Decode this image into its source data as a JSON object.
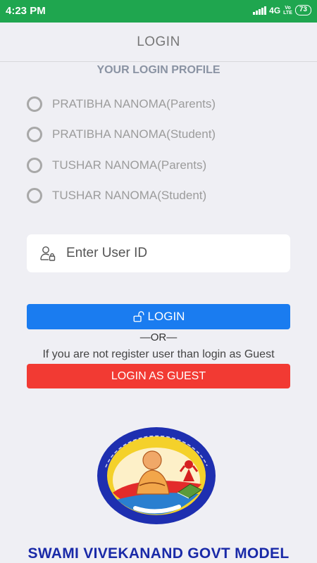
{
  "status_bar": {
    "time": "4:23 PM",
    "network": "4G",
    "volte_top": "Vo",
    "volte_bottom": "LTE",
    "battery": "73"
  },
  "app_bar": {
    "title": "LOGIN"
  },
  "profile": {
    "title": "YOUR LOGIN PROFILE",
    "options": [
      {
        "label": "PRATIBHA NANOMA(Parents)"
      },
      {
        "label": "PRATIBHA NANOMA(Student)"
      },
      {
        "label": "TUSHAR NANOMA(Parents)"
      },
      {
        "label": "TUSHAR NANOMA(Student)"
      }
    ]
  },
  "user_id": {
    "placeholder": "Enter User ID",
    "value": "",
    "icon": "user-lock-icon"
  },
  "login_button": {
    "label": "LOGIN",
    "icon": "unlock-icon"
  },
  "or_text": "—OR—",
  "guest_note": "If you are not register user than login as Guest",
  "guest_button": {
    "label": "LOGIN AS GUEST"
  },
  "school": {
    "name": "SWAMI VIVEKANAND GOVT MODEL"
  },
  "colors": {
    "status_bar": "#1fa64f",
    "login_button": "#1a7cf0",
    "guest_button": "#f23a33",
    "school_name": "#1a2aa8"
  }
}
